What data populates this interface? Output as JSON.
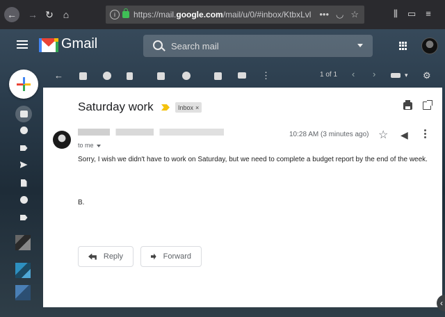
{
  "browser": {
    "url_prefix": "https://mail.",
    "url_domain": "google.com",
    "url_suffix": "/mail/u/0/#inbox/KtbxLvl",
    "page_actions_icon": "more-horizontal-icon",
    "pocket_icon": "pocket-icon",
    "bookmark_icon": "star-icon"
  },
  "header": {
    "logo_text": "Gmail",
    "search_placeholder": "Search mail"
  },
  "toolbar": {
    "pager": "1 of 1"
  },
  "email": {
    "subject": "Saturday work",
    "label": "Inbox",
    "label_close": "×",
    "recipient": "to me",
    "time": "10:28 AM (3 minutes ago)",
    "body": "Sorry, I wish we didn't have to work on Saturday, but we need to complete a budget report by the end of the week.",
    "signature": "B."
  },
  "actions": {
    "reply": "Reply",
    "forward": "Forward"
  },
  "colors": {
    "accent_red": "#ea4335",
    "accent_blue": "#4285f4",
    "accent_yellow": "#fbbc04",
    "accent_green": "#34a853"
  }
}
